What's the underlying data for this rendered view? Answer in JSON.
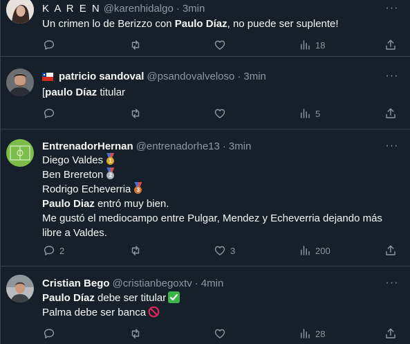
{
  "tweets": [
    {
      "name": "K A R E N",
      "handle": "@karenhidalgo",
      "time": "3min",
      "lines": [
        [
          {
            "t": "Un crimen lo de Berizzo con "
          },
          {
            "t": "Paulo Díaz",
            "b": true
          },
          {
            "t": ", no puede ser suplente!"
          }
        ]
      ],
      "replies": "",
      "retweets": "",
      "likes": "",
      "views": "18"
    },
    {
      "name": "patricio sandoval",
      "handle": "@psandovalveloso",
      "time": "3min",
      "lines": [
        [
          {
            "t": "["
          },
          {
            "t": "paulo Díaz",
            "b": true
          },
          {
            "t": " titular"
          }
        ]
      ],
      "replies": "",
      "retweets": "",
      "likes": "",
      "views": "5"
    },
    {
      "name": "EntrenadorHernan",
      "handle": "@entrenadorhe13",
      "time": "3min",
      "lines": [
        [
          {
            "t": "Diego Valdes"
          }
        ],
        [
          {
            "t": "Ben Brereton"
          }
        ],
        [
          {
            "t": "Rodrigo Echeverria"
          }
        ],
        [
          {
            "t": "Paulo Diaz",
            "b": true
          },
          {
            "t": " entró muy bien."
          }
        ],
        [
          {
            "t": "Me gustó el mediocampo entre Pulgar, Mendez y Echeverria dejando más"
          }
        ],
        [
          {
            "t": "libre a Valdes."
          }
        ]
      ],
      "medals": [
        "1",
        "2",
        "3"
      ],
      "replies": "2",
      "retweets": "",
      "likes": "3",
      "views": "200"
    },
    {
      "name": "Cristian Bego",
      "handle": "@cristianbegoxtv",
      "time": "4min",
      "lines": [
        [
          {
            "t": "Paulo Díaz",
            "b": true
          },
          {
            "t": " debe ser titular"
          }
        ],
        [
          {
            "t": "Palma debe ser banca"
          }
        ]
      ],
      "replies": "",
      "retweets": "",
      "likes": "",
      "views": "28"
    }
  ],
  "colors": {
    "background": "#15202b",
    "text": "#f7f9f9",
    "muted": "#8b98a5",
    "divider": "#38444d",
    "check_green": "#3bb54a",
    "prohibited_red": "#e0245e"
  },
  "icons": {
    "reply": "speech-bubble-icon",
    "retweet": "retweet-icon",
    "like": "heart-icon",
    "views": "bar-chart-icon",
    "share": "share-upload-icon",
    "more": "ellipsis-icon"
  }
}
